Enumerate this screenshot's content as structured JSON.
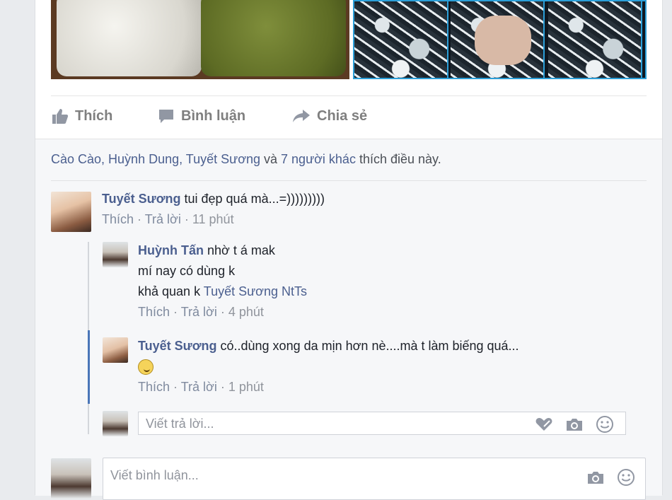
{
  "actions": {
    "like": "Thích",
    "comment": "Bình luận",
    "share": "Chia sẻ"
  },
  "likes": {
    "names": "Cào Cào, Huỳnh Dung, Tuyết Sương",
    "and": " và ",
    "others": "7 người khác",
    "suffix": " thích điều này."
  },
  "comments": [
    {
      "author": "Tuyết Sương",
      "text": " tui đẹp quá mà...=)))))))))",
      "like": "Thích",
      "reply": "Trả lời",
      "time": "11 phút"
    }
  ],
  "replies": [
    {
      "author": "Huỳnh Tấn",
      "line1": " nhờ t á mak",
      "line2": "mí nay có dùng k",
      "line3_prefix": "khả quan k ",
      "line3_tag": "Tuyết Sương NtTs",
      "like": "Thích",
      "reply": "Trả lời",
      "time": "4 phút"
    },
    {
      "author": "Tuyết Sương",
      "text": " có..dùng xong da mịn hơn nè....mà t làm biếng quá...",
      "emoji": "tongue-emoji",
      "like": "Thích",
      "reply": "Trả lời",
      "time": "1 phút"
    }
  ],
  "reply_input": {
    "placeholder": "Viết trả lời..."
  },
  "comment_input": {
    "placeholder": "Viết bình luận..."
  },
  "colors": {
    "link": "#4b5f8f",
    "thread_highlight": "#4a76b8",
    "photo_border": "#2b9fd9"
  }
}
